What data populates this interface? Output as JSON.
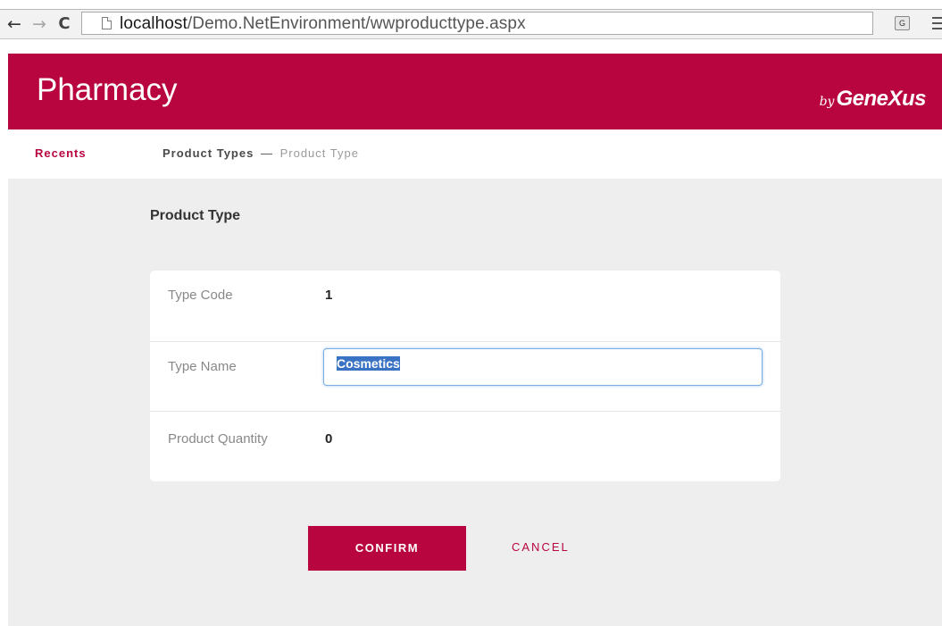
{
  "browser": {
    "back_icon": "←",
    "forward_icon": "→",
    "reload_icon": "C",
    "url_host": "localhost",
    "url_path": "/Demo.NetEnvironment/wwproducttype.aspx",
    "translate_icon": "G"
  },
  "header": {
    "title": "Pharmacy",
    "brand_by": "by",
    "brand_name": "GeneXus",
    "color": "#b9053f"
  },
  "breadcrumb": {
    "recents": "Recents",
    "parent": "Product Types",
    "separator": "—",
    "current": "Product Type"
  },
  "form": {
    "title": "Product Type",
    "fields": [
      {
        "label": "Type Code",
        "value": "1"
      },
      {
        "label": "Type Name",
        "value": "Cosmetics"
      },
      {
        "label": "Product Quantity",
        "value": "0"
      }
    ]
  },
  "actions": {
    "confirm": "CONFIRM",
    "cancel": "CANCEL"
  }
}
